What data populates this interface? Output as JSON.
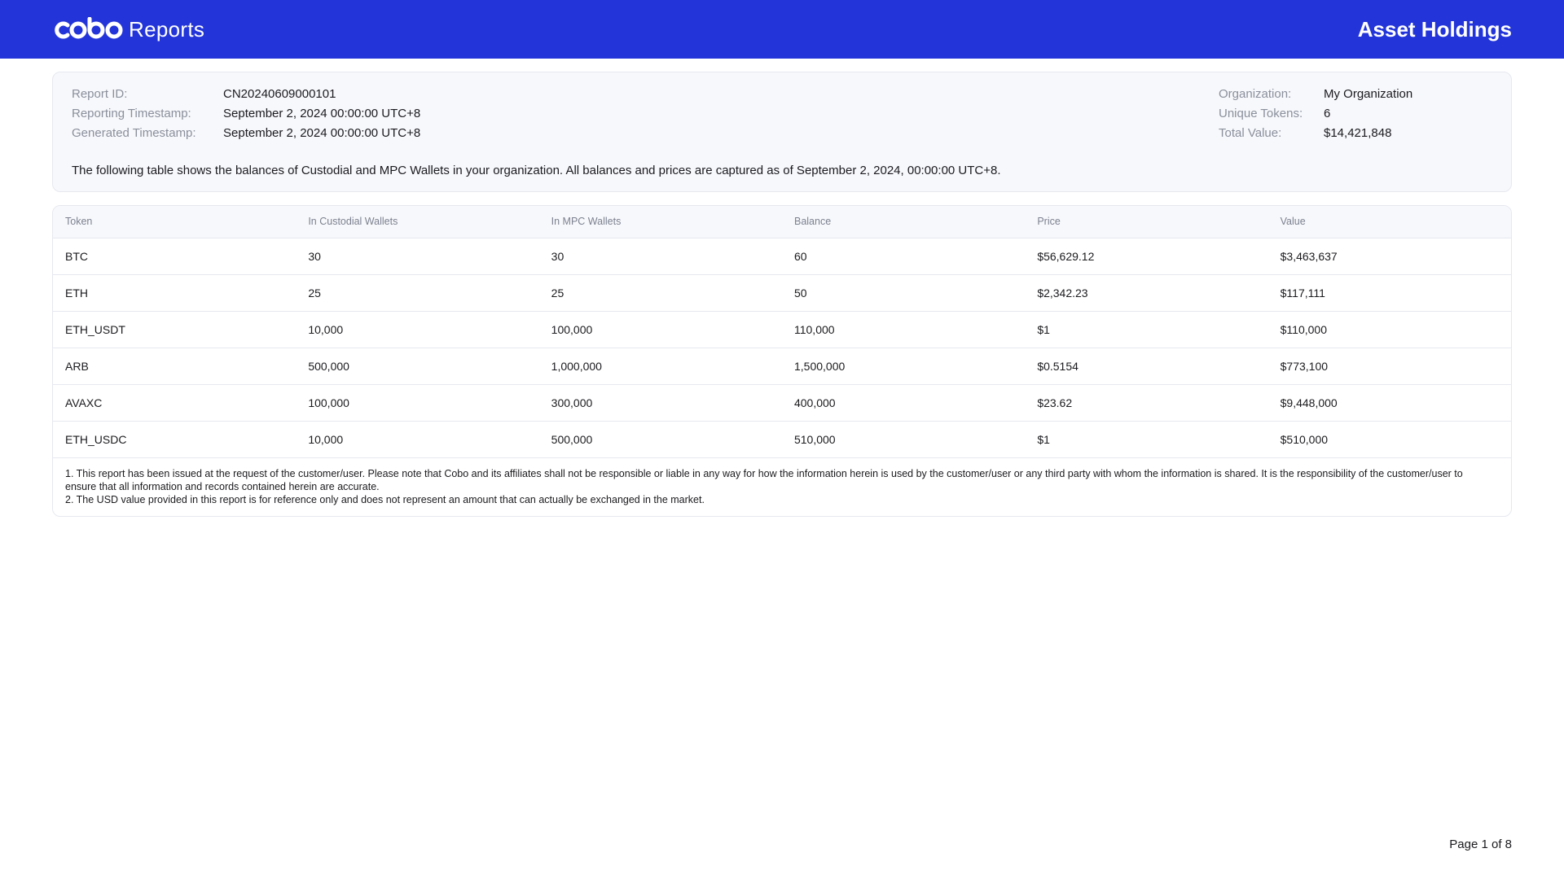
{
  "header": {
    "brand_name": "cobo",
    "brand_suffix": "Reports",
    "title": "Asset Holdings",
    "color": "#2335d9"
  },
  "summary": {
    "left": [
      {
        "label": "Report ID:",
        "value": "CN20240609000101"
      },
      {
        "label": "Reporting Timestamp:",
        "value": "September 2, 2024 00:00:00 UTC+8"
      },
      {
        "label": "Generated Timestamp:",
        "value": "September 2, 2024 00:00:00 UTC+8"
      }
    ],
    "right": [
      {
        "label": "Organization:",
        "value": "My Organization"
      },
      {
        "label": "Unique Tokens:",
        "value": "6"
      },
      {
        "label": "Total Value:",
        "value": "$14,421,848"
      }
    ],
    "description": "The following table shows the balances of Custodial and MPC Wallets in your organization. All balances and prices are captured as of September 2, 2024, 00:00:00 UTC+8."
  },
  "table": {
    "columns": [
      "Token",
      "In Custodial Wallets",
      "In MPC Wallets",
      "Balance",
      "Price",
      "Value"
    ],
    "rows": [
      [
        "BTC",
        "30",
        "30",
        "60",
        "$56,629.12",
        "$3,463,637"
      ],
      [
        "ETH",
        "25",
        "25",
        "50",
        "$2,342.23",
        "$117,111"
      ],
      [
        "ETH_USDT",
        "10,000",
        "100,000",
        "110,000",
        "$1",
        "$110,000"
      ],
      [
        "ARB",
        "500,000",
        "1,000,000",
        "1,500,000",
        "$0.5154",
        "$773,100"
      ],
      [
        "AVAXC",
        "100,000",
        "300,000",
        "400,000",
        "$23.62",
        "$9,448,000"
      ],
      [
        "ETH_USDC",
        "10,000",
        "500,000",
        "510,000",
        "$1",
        "$510,000"
      ]
    ]
  },
  "notes": [
    "1. This report has been issued at the request of the customer/user. Please note that Cobo and its affiliates shall not be responsible or liable in any way for how the information herein is used by the customer/user or any third party with whom the information is shared. It is the responsibility of the customer/user to ensure that all information and records contained herein are accurate.",
    "2. The USD value provided in this report is for reference only and does not represent an amount that can actually be exchanged in the market."
  ],
  "footer": {
    "page_label": "Page 1 of 8"
  }
}
